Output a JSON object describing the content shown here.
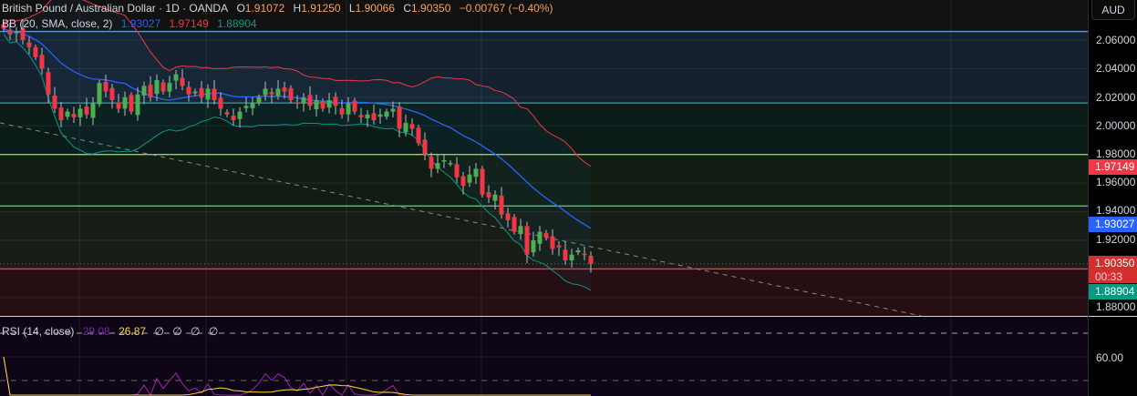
{
  "header": {
    "symbol": "British Pound / Australian Dollar · 1D · OANDA",
    "o_label": "O",
    "open": "1.91072",
    "h_label": "H",
    "high": "1.91250",
    "l_label": "L",
    "low": "1.90066",
    "c_label": "C",
    "close": "1.90350",
    "change": "−0.00767 (−0.40%)"
  },
  "bb": {
    "label": "BB (20, SMA, close, 2)",
    "basis": "1.93027",
    "upper": "1.97149",
    "lower": "1.88904"
  },
  "rsi": {
    "label": "RSI (14, close)",
    "value": "29.08",
    "ma": "26.87",
    "extras": [
      "∅",
      "∅",
      "∅",
      "∅"
    ]
  },
  "axis": {
    "currency": "AUD",
    "ticks": [
      "2.06000",
      "2.04000",
      "2.02000",
      "2.00000",
      "1.98000",
      "1.96000",
      "1.94000",
      "1.92000",
      "1.88000"
    ],
    "rsi_tick": "60.00",
    "upper_label": "1.97149",
    "basis_label": "1.93027",
    "last_price": "1.90350",
    "countdown": "00:33",
    "lower_label": "1.88904"
  },
  "colors": {
    "up": "#4caf50",
    "down": "#f23645",
    "basis": "#2962ff",
    "upper": "#f23645",
    "lower": "#089981",
    "rsi": "#9c27b0",
    "rsi_ma": "#fdd835"
  },
  "chart_data": {
    "type": "candlestick",
    "closes": [
      2.068,
      2.064,
      2.066,
      2.06,
      2.055,
      2.048,
      2.04,
      2.022,
      2.012,
      2.004,
      2.01,
      2.006,
      2.012,
      2.008,
      2.016,
      2.03,
      2.024,
      2.018,
      2.012,
      2.02,
      2.01,
      2.022,
      2.028,
      2.02,
      2.032,
      2.024,
      2.03,
      2.036,
      2.028,
      2.022,
      2.024,
      2.02,
      2.026,
      2.018,
      2.012,
      2.008,
      2.004,
      2.01,
      2.014,
      2.016,
      2.02,
      2.026,
      2.022,
      2.026,
      2.024,
      2.018,
      2.016,
      2.02,
      2.014,
      2.018,
      2.012,
      2.018,
      2.014,
      2.008,
      2.016,
      2.01,
      2.006,
      2.008,
      2.004,
      2.008,
      2.01,
      2.012,
      1.998,
      2.002,
      1.998,
      1.988,
      1.98,
      1.97,
      1.974,
      1.976,
      1.974,
      1.964,
      1.958,
      1.966,
      1.97,
      1.952,
      1.95,
      1.952,
      1.938,
      1.934,
      1.926,
      1.93,
      1.91,
      1.92,
      1.926,
      1.922,
      1.914,
      1.915,
      1.906,
      1.91,
      1.913,
      1.91,
      1.9035
    ],
    "ylim": [
      1.87,
      2.07
    ],
    "levels": [
      2.066,
      2.016,
      1.98,
      1.944,
      1.9
    ]
  }
}
